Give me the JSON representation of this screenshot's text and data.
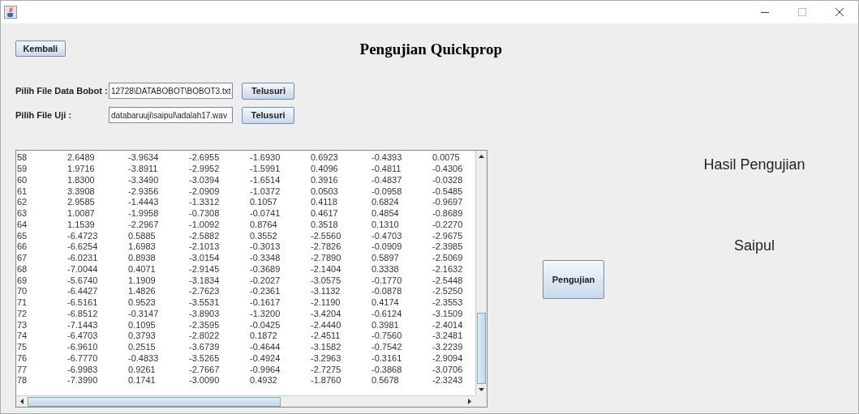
{
  "window": {
    "buttons": [
      {
        "kind": "minimize"
      },
      {
        "kind": "maximize",
        "disabled": true
      },
      {
        "kind": "close"
      }
    ]
  },
  "back_button": "Kembali",
  "title": "Pengujian Quickprop",
  "file_rows": [
    {
      "label": "Pilih File Data Bobot :",
      "value": "12728\\DATABOBOT\\BOBOT3.txt",
      "button": "Telusuri"
    },
    {
      "label": "Pilih File Uji :",
      "value": "databaruuji\\saipul\\adalah17.wav",
      "button": "Telusuri"
    }
  ],
  "table": {
    "rows": [
      [
        "58",
        "2.6489",
        "-3.9634",
        "-2.6955",
        "-1.6930",
        "0.6923",
        "-0.4393",
        "0.0075"
      ],
      [
        "59",
        "1.9716",
        "-3.8911",
        "-2.9952",
        "-1.5991",
        "0.4096",
        "-0.4811",
        "-0.4306"
      ],
      [
        "60",
        "1.8300",
        "-3.3490",
        "-3.0394",
        "-1.6514",
        "0.3916",
        "-0.4837",
        "-0.0328"
      ],
      [
        "61",
        "3.3908",
        "-2.9356",
        "-2.0909",
        "-1.0372",
        "0.0503",
        "-0.0958",
        "-0.5485"
      ],
      [
        "62",
        "2.9585",
        "-1.4443",
        "-1.3312",
        "0.1057",
        "0.4118",
        "0.6824",
        "-0.9697"
      ],
      [
        "63",
        "1.0087",
        "-1.9958",
        "-0.7308",
        "-0.0741",
        "0.4617",
        "0.4854",
        "-0.8689"
      ],
      [
        "64",
        "1.1539",
        "-2.2967",
        "-1.0092",
        "0.8764",
        "0.3518",
        "0.1310",
        "-0.2270"
      ],
      [
        "65",
        "-6.4723",
        "0.5885",
        "-2.5882",
        "0.3552",
        "-2.5560",
        "-0.4703",
        "-2.9675"
      ],
      [
        "66",
        "-6.6254",
        "1.6983",
        "-2.1013",
        "-0.3013",
        "-2.7826",
        "-0.0909",
        "-2.3985"
      ],
      [
        "67",
        "-6.0231",
        "0.8938",
        "-3.0154",
        "-0.3348",
        "-2.7890",
        "0.5897",
        "-2.5069"
      ],
      [
        "68",
        "-7.0044",
        "0.4071",
        "-2.9145",
        "-0.3689",
        "-2.1404",
        "0.3338",
        "-2.1632"
      ],
      [
        "69",
        "-5.6740",
        "1.1909",
        "-3.1834",
        "-0.2027",
        "-3.0575",
        "-0.1770",
        "-2.5448"
      ],
      [
        "70",
        "-6.4427",
        "1.4826",
        "-2.7623",
        "-0.2361",
        "-3.1132",
        "-0.0878",
        "-2.5250"
      ],
      [
        "71",
        "-6.5161",
        "0.9523",
        "-3.5531",
        "-0.1617",
        "-2.1190",
        "0.4174",
        "-2.3553"
      ],
      [
        "72",
        "-6.8512",
        "-0.3147",
        "-3.8903",
        "-1.3200",
        "-3.4204",
        "-0.6124",
        "-3.1509"
      ],
      [
        "73",
        "-7.1443",
        "0.1095",
        "-2.3595",
        "-0.0425",
        "-2.4440",
        "0.3981",
        "-2.4014"
      ],
      [
        "74",
        "-6.4703",
        "0.3793",
        "-2.8022",
        "0.1872",
        "-2.4511",
        "-0.7560",
        "-3.2481"
      ],
      [
        "75",
        "-6.9610",
        "0.2515",
        "-3.6739",
        "-0.4644",
        "-3.1582",
        "-0.7542",
        "-3.2239"
      ],
      [
        "76",
        "-6.7770",
        "-0.4833",
        "-3.5265",
        "-0.4924",
        "-3.2963",
        "-0.3161",
        "-2.9094"
      ],
      [
        "77",
        "-6.9983",
        "0.9261",
        "-2.7667",
        "-0.9964",
        "-2.7275",
        "-0.3868",
        "-3.0706"
      ],
      [
        "78",
        "-7.3990",
        "0.1741",
        "-3.0090",
        "0.4932",
        "-1.8760",
        "0.5678",
        "-2.3243"
      ]
    ]
  },
  "result_heading": "Hasil Pengujian",
  "result_value": "Saipul",
  "test_button": "Pengujian"
}
